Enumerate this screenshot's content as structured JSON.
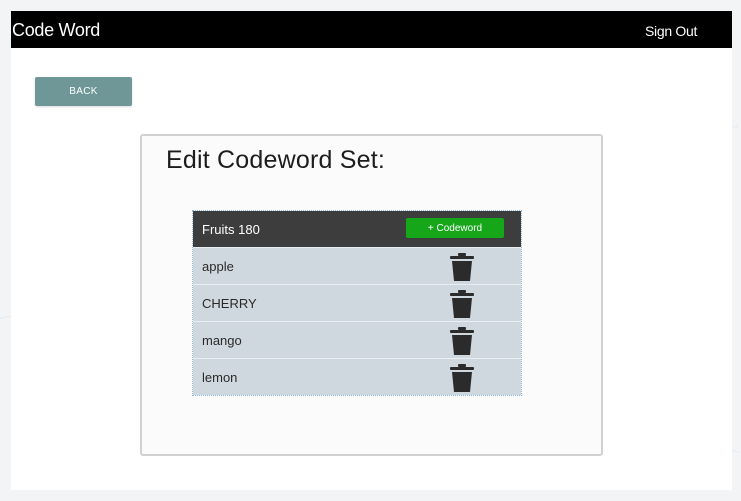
{
  "header": {
    "app_title": "Code Word",
    "sign_out_label": "Sign Out"
  },
  "back_label": "BACK",
  "panel": {
    "title": "Edit Codeword Set:",
    "set_name": "Fruits 180",
    "add_label": "+ Codeword",
    "codewords": [
      {
        "word": "apple",
        "delete_icon": "trash-icon"
      },
      {
        "word": "CHERRY",
        "delete_icon": "trash-icon"
      },
      {
        "word": "mango",
        "delete_icon": "trash-icon"
      },
      {
        "word": "lemon",
        "delete_icon": "trash-icon"
      }
    ]
  },
  "colors": {
    "topbar": "#000000",
    "back_button": "#6f9797",
    "add_button": "#15a61a",
    "table_header": "#3d3d3d",
    "row_background": "#cfd8de"
  }
}
